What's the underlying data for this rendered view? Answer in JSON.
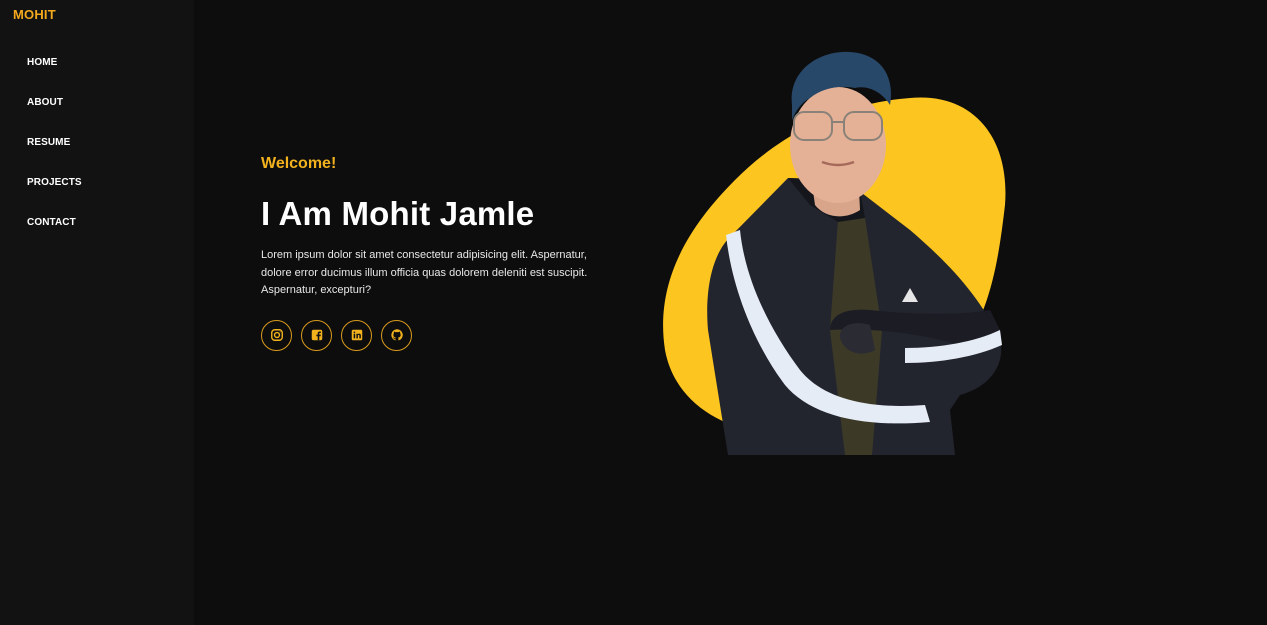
{
  "brand": {
    "name": "MOHIT",
    "color": "#f3a81e"
  },
  "nav": {
    "items": [
      {
        "label": "HOME"
      },
      {
        "label": "ABOUT"
      },
      {
        "label": "RESUME"
      },
      {
        "label": "PROJECTS"
      },
      {
        "label": "CONTACT"
      }
    ]
  },
  "hero": {
    "welcome": "Welcome!",
    "title": "I Am Mohit Jamle",
    "description": "Lorem ipsum dolor sit amet consectetur adipisicing elit. Aspernatur, dolore error ducimus illum officia quas dolorem deleniti est suscipit. Aspernatur, excepturi?",
    "accent_color": "#f2b21e"
  },
  "socials": [
    {
      "icon": "instagram-icon"
    },
    {
      "icon": "facebook-icon"
    },
    {
      "icon": "linkedin-icon"
    },
    {
      "icon": "github-icon"
    }
  ],
  "portrait": {
    "blob_color": "#fdc51f"
  }
}
